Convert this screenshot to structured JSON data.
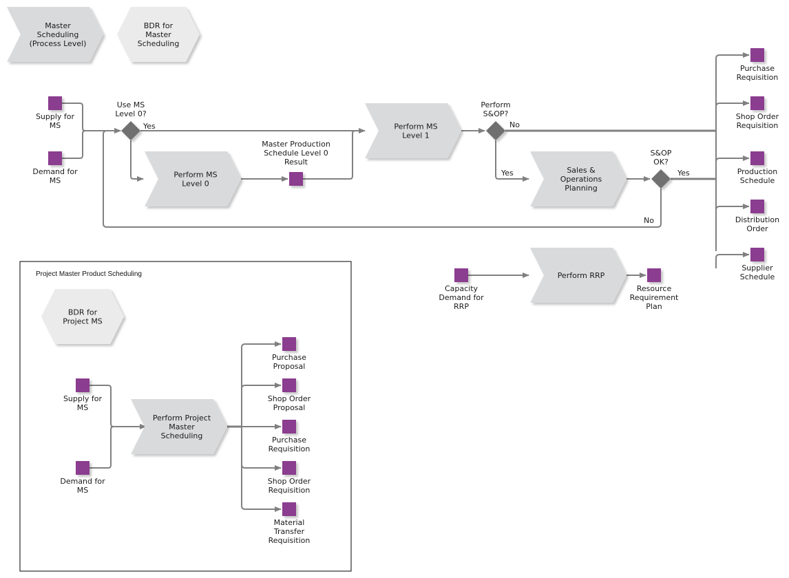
{
  "colors": {
    "process_fill": "#d9dadb",
    "process_fill_light": "#e8e8e8",
    "bdr_fill": "#ebebeb",
    "event_fill": "#8b3c8f",
    "gateway_fill": "#707070",
    "edge": "#808080",
    "group_border": "#000000"
  },
  "top_nav": [
    {
      "id": "master-scheduling",
      "label": [
        "Master",
        "Scheduling",
        "(Process Level)"
      ],
      "shape": "chevron"
    },
    {
      "id": "bdr-master-scheduling",
      "label": [
        "BDR for",
        "Master",
        "Scheduling"
      ],
      "shape": "hexagon"
    }
  ],
  "main_flow": {
    "inputs": [
      {
        "id": "supply-for-ms",
        "label": [
          "Supply for",
          "MS"
        ]
      },
      {
        "id": "demand-for-ms",
        "label": [
          "Demand for",
          "MS"
        ]
      }
    ],
    "gateways": [
      {
        "id": "use-ms-level-0",
        "label": [
          "Use MS",
          "Level 0?"
        ],
        "yes": "Yes"
      },
      {
        "id": "perform-sop",
        "label": [
          "Perform",
          "S&OP?"
        ],
        "yes": "Yes",
        "no": "No"
      },
      {
        "id": "sop-ok",
        "label": [
          "S&OP",
          "OK?"
        ],
        "yes": "Yes",
        "no": "No"
      }
    ],
    "processes": [
      {
        "id": "perform-ms-level-0",
        "label": [
          "Perform MS",
          "Level 0"
        ]
      },
      {
        "id": "perform-ms-level-1",
        "label": [
          "Perform MS",
          "Level 1"
        ]
      },
      {
        "id": "sales-operations-planning",
        "label": [
          "Sales &",
          "Operations",
          "Planning"
        ]
      }
    ],
    "intermediate": {
      "id": "mps-level-0-result",
      "label": [
        "Master Production",
        "Schedule Level 0",
        "Result"
      ]
    },
    "outputs": [
      {
        "id": "purchase-requisition",
        "label": [
          "Purchase",
          "Requisition"
        ]
      },
      {
        "id": "shop-order-requisition",
        "label": [
          "Shop Order",
          "Requisition"
        ]
      },
      {
        "id": "production-schedule",
        "label": [
          "Production",
          "Schedule"
        ]
      },
      {
        "id": "distribution-order",
        "label": [
          "Distribution",
          "Order"
        ]
      },
      {
        "id": "supplier-schedule",
        "label": [
          "Supplier",
          "Schedule"
        ]
      }
    ]
  },
  "rrp_flow": {
    "input": {
      "id": "capacity-demand-rrp",
      "label": [
        "Capacity",
        "Demand for",
        "RRP"
      ]
    },
    "process": {
      "id": "perform-rrp",
      "label": [
        "Perform RRP"
      ]
    },
    "output": {
      "id": "resource-requirement-plan",
      "label": [
        "Resource",
        "Requirement",
        "Plan"
      ]
    }
  },
  "project_group": {
    "title": "Project Master Product Scheduling",
    "bdr": {
      "id": "bdr-project-ms",
      "label": [
        "BDR for",
        "Project MS"
      ]
    },
    "inputs": [
      {
        "id": "project-supply-for-ms",
        "label": [
          "Supply for",
          "MS"
        ]
      },
      {
        "id": "project-demand-for-ms",
        "label": [
          "Demand for",
          "MS"
        ]
      }
    ],
    "process": {
      "id": "perform-project-master-scheduling",
      "label": [
        "Perform Project",
        "Master",
        "Scheduling"
      ]
    },
    "outputs": [
      {
        "id": "purchase-proposal",
        "label": [
          "Purchase",
          "Proposal"
        ]
      },
      {
        "id": "shop-order-proposal",
        "label": [
          "Shop Order",
          "Proposal"
        ]
      },
      {
        "id": "project-purchase-requisition",
        "label": [
          "Purchase",
          "Requisition"
        ]
      },
      {
        "id": "project-shop-order-requisition",
        "label": [
          "Shop Order",
          "Requisition"
        ]
      },
      {
        "id": "material-transfer-requisition",
        "label": [
          "Material",
          "Transfer",
          "Requisition"
        ]
      }
    ]
  }
}
